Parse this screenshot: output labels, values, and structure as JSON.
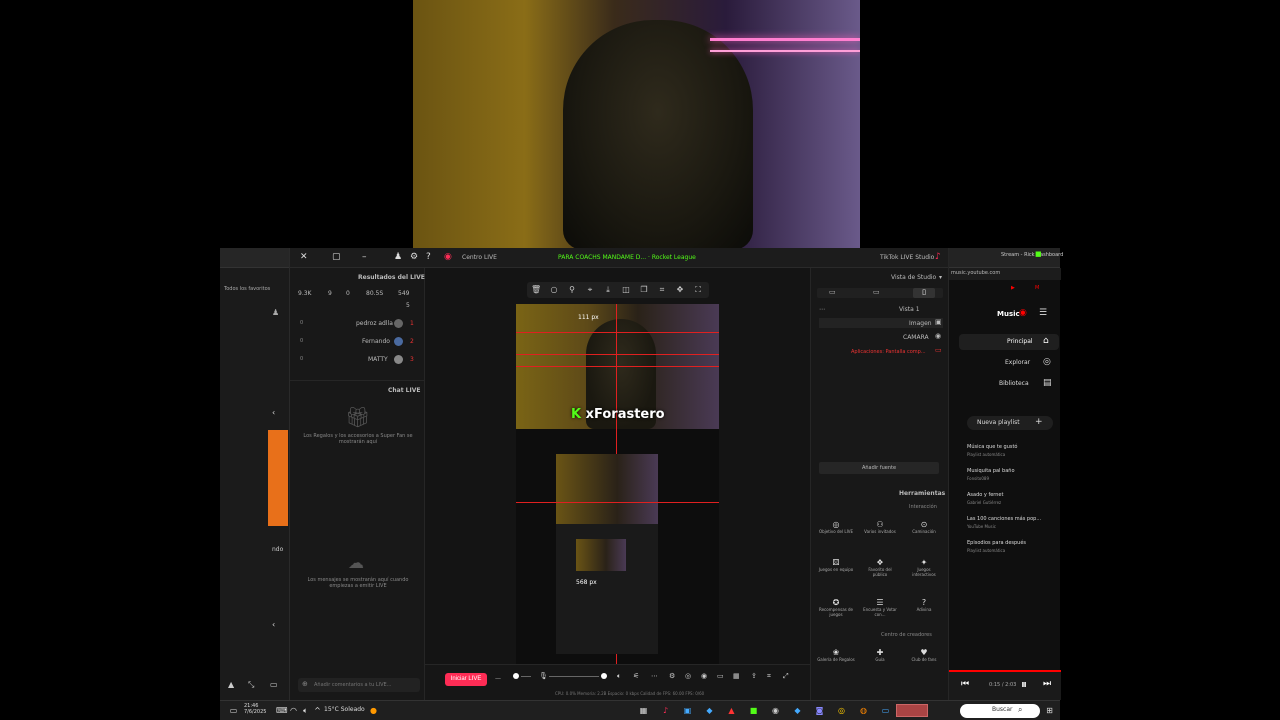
{
  "left_browser": {
    "tab_label": "Todos los favoritos",
    "bottom_text": "ndo"
  },
  "studio": {
    "titlebar": {
      "app_title": "TikTok LIVE Studio",
      "stream_title": "PARA COACHS MANDAME D... · Rocket League",
      "control_label": "Centro LIVE"
    },
    "left": {
      "results_title": "Resultados del LIVE",
      "stats": [
        "549",
        "80.5S",
        "0",
        "9",
        "9.3K"
      ],
      "viewers_count": "5",
      "ranking": [
        {
          "name": "pedroz adlla",
          "rank": "1",
          "score": "0"
        },
        {
          "name": "Fernando",
          "rank": "2",
          "score": "0"
        },
        {
          "name": "MATTY",
          "rank": "3",
          "score": "0"
        }
      ],
      "chat_title": "Chat LIVE",
      "chat_empty": "Los Regalos y los accesorios a Super Fan se mostrarán aquí",
      "chat_empty2": "Los mensajes se mostrarán aquí cuando empiezas a emitir LIVE",
      "chat_input_placeholder": "Añadir comentarios a tu LIVE..."
    },
    "center": {
      "px_top": "111 px",
      "px_mid": "568 px",
      "brand": "xForastero",
      "brand_k": "K",
      "go_live": "Iniciar LIVE",
      "stats_line": "CPU: 0.0%  Memoria: 2.2B  Espacio: 0 kbps  Calidad de FPS: 60.00  FPS: 0/60"
    },
    "right": {
      "header": "Vista de Studio",
      "scene": "Vista 1",
      "sources": [
        "Imagen",
        "CAMARA",
        "Aplicaciones: Pantalla comp..."
      ],
      "add_source": "Añadir fuente",
      "tools_title": "Herramientas",
      "interaction_label": "Interacción",
      "tools": [
        {
          "label": "Objetivo del LIVE",
          "icon": "◎"
        },
        {
          "label": "Varios invitados",
          "icon": "⚇"
        },
        {
          "label": "Caminación",
          "icon": "⊙"
        },
        {
          "label": "Juegos en equipo",
          "icon": "⚄"
        },
        {
          "label": "Favorito del público",
          "icon": "❖"
        },
        {
          "label": "Juegos interactivos",
          "icon": "✦"
        },
        {
          "label": "Recompensas de juegos",
          "icon": "✪"
        },
        {
          "label": "Encuesta y Votar con...",
          "icon": "☰"
        },
        {
          "label": "Adivina",
          "icon": "?"
        },
        {
          "label": "Galería de Regalos",
          "icon": "❀"
        },
        {
          "label": "Guía",
          "icon": "✚"
        },
        {
          "label": "Club de fans",
          "icon": "♥"
        }
      ],
      "creator_label": "Centro de creadores"
    }
  },
  "music": {
    "tab_label": "Stream - Rick Dashboard",
    "url": "music.youtube.com",
    "logo": "Music",
    "nav": [
      {
        "label": "Principal",
        "icon": "⌂"
      },
      {
        "label": "Explorar",
        "icon": "◎"
      },
      {
        "label": "Biblioteca",
        "icon": "▤"
      }
    ],
    "new_playlist": "Nueva playlist",
    "playlists": [
      {
        "title": "Música que te gustó",
        "sub": "Playlist automática"
      },
      {
        "title": "Musiquita pal baño",
        "sub": "Fonsito089"
      },
      {
        "title": "Asado y fernet",
        "sub": "Gabriel Gutiérrez"
      },
      {
        "title": "Las 100 canciones más pop...",
        "sub": "YouTube Music"
      },
      {
        "title": "Episodios para después",
        "sub": "Playlist automática"
      }
    ],
    "time": "0:15 / 2:03"
  },
  "taskbar": {
    "weather": "15°C  Soleado",
    "search": "Buscar",
    "clock_time": "21:46",
    "clock_date": "7/6/2025"
  },
  "colors": {
    "accent_live": "#fe2c55",
    "kick_green": "#53fc18",
    "youtube_red": "#ff0000"
  }
}
